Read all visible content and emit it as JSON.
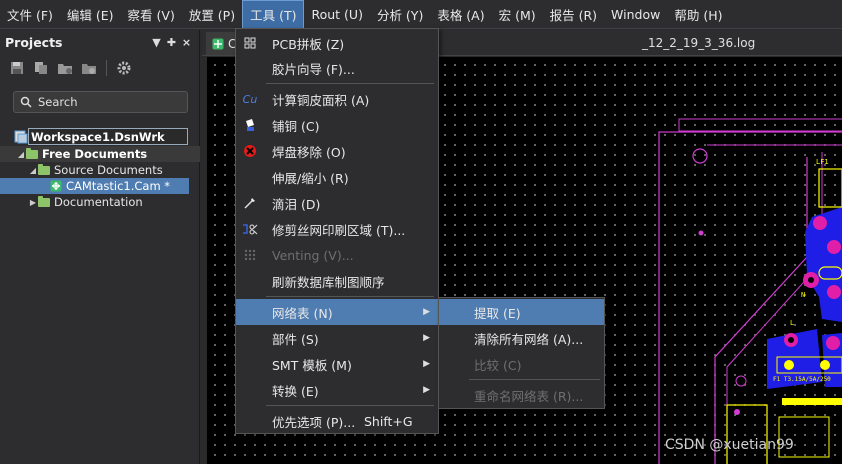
{
  "menubar": {
    "items": [
      "文件 (F)",
      "编辑 (E)",
      "察看 (V)",
      "放置 (P)",
      "工具 (T)",
      "Rout (U)",
      "分析 (Y)",
      "表格 (A)",
      "宏 (M)",
      "报告 (R)",
      "Window",
      "帮助 (H)"
    ]
  },
  "panel": {
    "title": "Projects",
    "controls": [
      "▼",
      "✚",
      "×"
    ],
    "search_placeholder": "Search",
    "tree": {
      "workspace": "Workspace1.DsnWrk",
      "free_documents": "Free Documents",
      "source_documents": "Source Documents",
      "cam_file": "CAMtastic1.Cam *",
      "documentation": "Documentation"
    }
  },
  "tabs": {
    "cam_short": "C",
    "log_name": "_12_2_19_3_36.log"
  },
  "tools_menu": {
    "items": [
      {
        "label": "PCB拼板 (Z)",
        "icon": "grid-icon"
      },
      {
        "label": "胶片向导 (F)..."
      },
      {
        "label": "计算铜皮面积 (A)",
        "icon": "cu-icon"
      },
      {
        "label": "铺铜 (C)",
        "icon": "pour-icon"
      },
      {
        "label": "焊盘移除 (O)",
        "icon": "remove-pad-icon"
      },
      {
        "label": "伸展/缩小 (R)"
      },
      {
        "label": "滴泪 (D)",
        "icon": "teardrop-icon"
      },
      {
        "label": "修剪丝网印刷区域 (T)...",
        "icon": "trim-silk-icon"
      },
      {
        "label": "Venting (V)...",
        "icon": "venting-icon",
        "disabled": true
      },
      {
        "label": "刷新数据库制图顺序"
      },
      {
        "label": "网络表 (N)",
        "submenu": true,
        "highlighted": true
      },
      {
        "label": "部件 (S)",
        "submenu": true
      },
      {
        "label": "SMT 模板 (M)",
        "submenu": true
      },
      {
        "label": "转换 (E)",
        "submenu": true
      },
      {
        "label": "优先选项 (P)...",
        "shortcut": "Shift+G"
      }
    ]
  },
  "netlist_menu": {
    "items": [
      {
        "label": "提取 (E)",
        "highlighted": true
      },
      {
        "label": "清除所有网络 (A)..."
      },
      {
        "label": "比较 (C)",
        "disabled": true
      },
      {
        "label": "重命名网络表 (R)...",
        "disabled": true
      }
    ]
  },
  "pcb_labels": {
    "lf1": "LF1",
    "fuse": "F1  T3.15A/5A/250",
    "n": "N",
    "l": "L"
  },
  "watermark": "CSDN @xuetian99",
  "colors": {
    "menu_bg": "#2d2d30",
    "highlight": "#4f7db1",
    "pcb_outline": "#d23cd2",
    "pcb_copper": "#1e1ee6",
    "pcb_pad": "#e01ea8",
    "pcb_silk": "#ffff00"
  }
}
